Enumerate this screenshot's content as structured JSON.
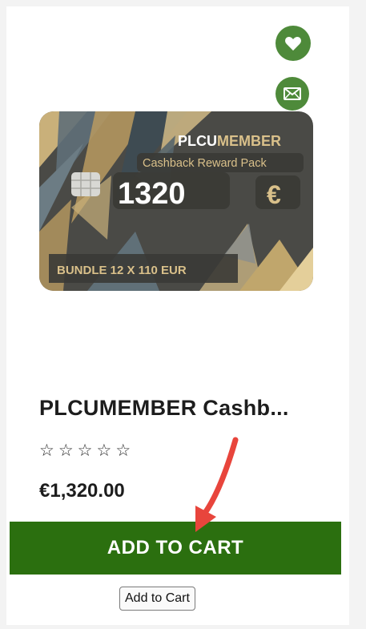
{
  "icons": {
    "wishlist": "heart-icon",
    "email": "envelope-icon"
  },
  "image": {
    "brand_prefix": "PLCU",
    "brand_suffix": "MEMBER",
    "subtitle": "Cashback Reward Pack",
    "amount": "1320",
    "currency": "€",
    "bundle": "BUNDLE 12 X 110 EUR"
  },
  "product": {
    "title": "PLCUMEMBER Cashb...",
    "stars": [
      "☆",
      "☆",
      "☆",
      "☆",
      "☆"
    ],
    "rating_out_of_5": 0,
    "price": "€1,320.00"
  },
  "buttons": {
    "add_to_cart": "ADD TO CART",
    "add_to_cart_small": "Add to Cart"
  },
  "colors": {
    "accent_green": "#4e8a3a",
    "cart_green": "#2b6f0f",
    "annotation_red": "#e8453c",
    "card_dark": "#4a4a46",
    "gold": "#d9c08a"
  }
}
